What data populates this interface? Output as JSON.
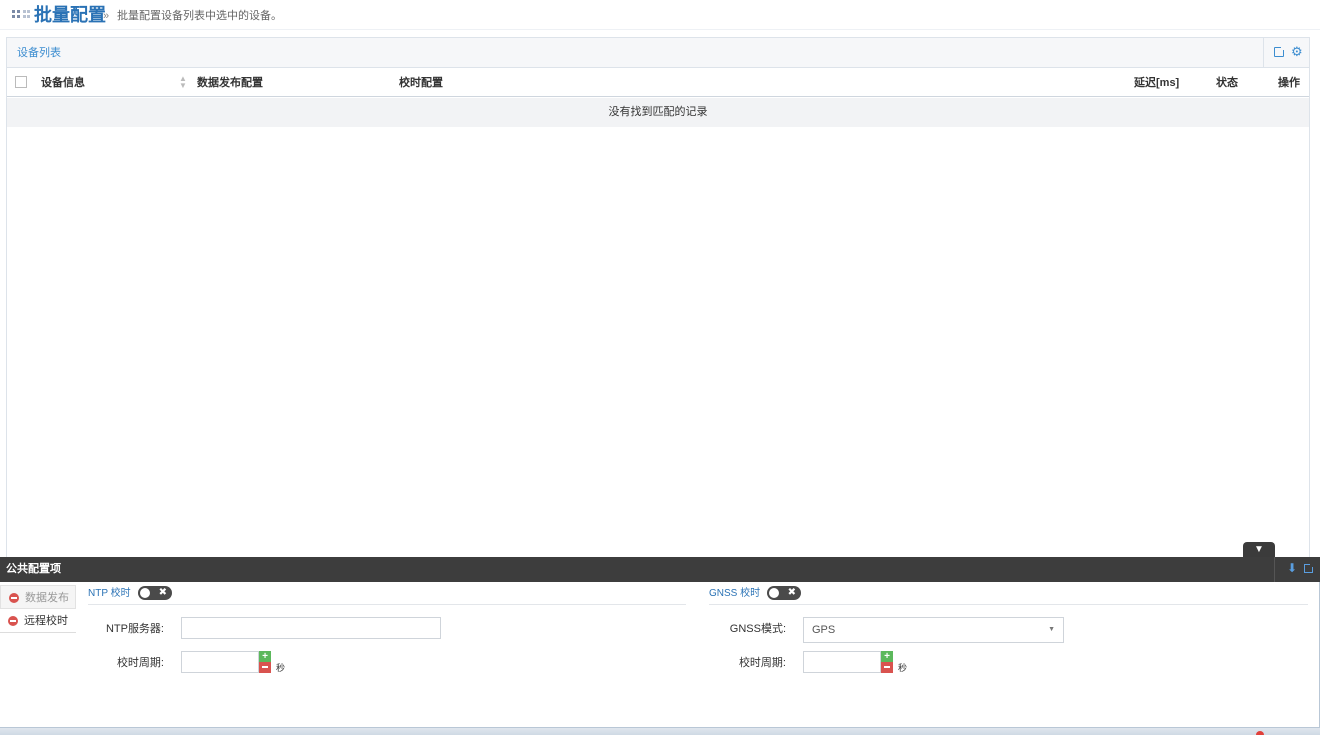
{
  "header": {
    "title": "批量配置",
    "separator": "»",
    "breadcrumb": "批量配置设备列表中选中的设备。"
  },
  "device_list": {
    "title": "设备列表",
    "columns": [
      "设备信息",
      "数据发布配置",
      "校时配置",
      "延迟[ms]",
      "状态",
      "操作"
    ],
    "empty_message": "没有找到匹配的记录",
    "icons": [
      "external-link-icon",
      "gear-icon"
    ]
  },
  "config": {
    "title": "公共配置项",
    "tabs": [
      "数据发布",
      "远程校时"
    ],
    "ntp": {
      "section_label": "NTP 校时",
      "enabled": false,
      "server_label": "NTP服务器:",
      "server_value": "",
      "period_label": "校时周期:",
      "period_value": "",
      "unit": "秒"
    },
    "gnss": {
      "section_label": "GNSS 校时",
      "enabled": false,
      "mode_label": "GNSS模式:",
      "mode_value": "GPS",
      "period_label": "校时周期:",
      "period_value": "",
      "unit": "秒"
    }
  },
  "colors": {
    "accent": "#2a72b5",
    "dock_bar": "#3d3d3d",
    "minus_red": "#d9534f",
    "plus_green": "#5cb85c"
  }
}
